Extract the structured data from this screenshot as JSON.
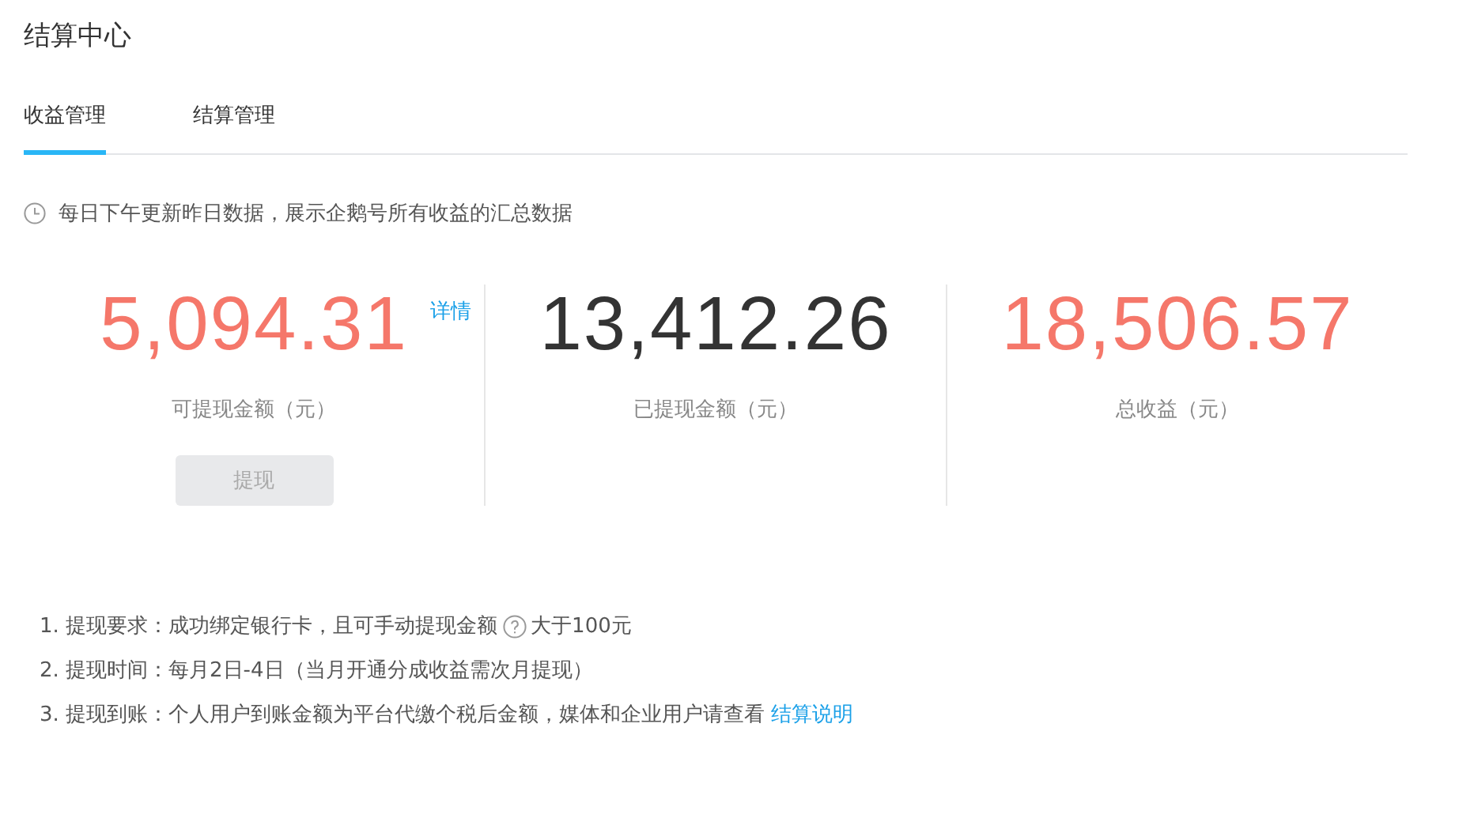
{
  "title": "结算中心",
  "tabs": [
    {
      "label": "收益管理",
      "selected": true
    },
    {
      "label": "结算管理",
      "selected": false
    }
  ],
  "notice": "每日下午更新昨日数据，展示企鹅号所有收益的汇总数据",
  "stats": [
    {
      "value": "5,094.31",
      "color": "#f5776a",
      "label": "可提现金额（元）",
      "link": "详情",
      "button": {
        "label": "提现",
        "disabled": true
      }
    },
    {
      "value": "13,412.26",
      "color": "#333333",
      "label": "已提现金额（元）"
    },
    {
      "value": "18,506.57",
      "color": "#f5776a",
      "label": "总收益（元）"
    }
  ],
  "notes": [
    {
      "kind": "help",
      "text": "1. 提现要求：成功绑定银行卡，且可手动提现金额",
      "after": "大于100元"
    },
    {
      "kind": "plain",
      "text": "2. 提现时间：每月2日-4日（当月开通分成收益需次月提现）"
    },
    {
      "kind": "link",
      "text": "3. 提现到账：个人用户到账金额为平台代缴个税后金额，媒体和企业用户请查看",
      "link": "结算说明"
    }
  ]
}
